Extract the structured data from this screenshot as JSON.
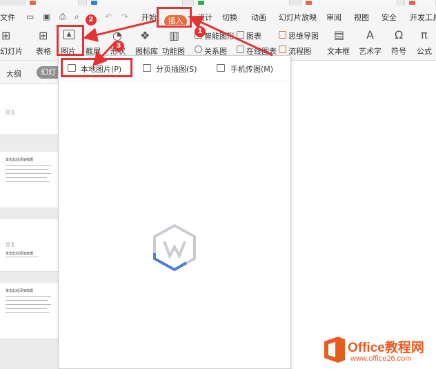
{
  "menu": {
    "file": "文件",
    "start": "开始",
    "insert": "插入",
    "design": "设计",
    "transition": "切换",
    "animation": "动画",
    "slideshow": "幻灯片放映",
    "review": "审阅",
    "view": "视图",
    "security": "安全",
    "dev_tools": "开发工具"
  },
  "ribbon": {
    "slides": "幻灯片",
    "table": "表格",
    "picture": "图片",
    "screenshot": "截屏",
    "shapes": "形状",
    "icon_library": "图标库",
    "function_chart": "功能图",
    "smart_graphic": "智能图形",
    "chart": "图表",
    "mindmap": "思维导图",
    "relation": "关系图",
    "online_chart": "在线图表",
    "flowchart": "流程图",
    "textbox": "文本框",
    "wordart": "艺术字",
    "symbol": "符号",
    "formula": "公式"
  },
  "sidebar": {
    "outline": "大纲",
    "slides": "幻灯片",
    "slide_numbers": [
      "01",
      "01"
    ],
    "thumb_title_a": "单击此处添加标题",
    "thumb_title_b": "单击此处添加标题"
  },
  "dropdown": {
    "local_picture": "本地图片(P)",
    "paged_illustration": "分页插图(S)",
    "phone_picture": "手机传图(M)"
  },
  "steps": [
    "1",
    "2",
    "3"
  ],
  "watermark": {
    "brand": "Office教程网",
    "url": "www.office26.com"
  },
  "colors": {
    "accent": "#ea6d3b",
    "highlight": "#e63232",
    "wps_logo_blue": "#4a7fd6",
    "wps_logo_grey": "#c9cdd2",
    "watermark": "#ea5b1f"
  }
}
